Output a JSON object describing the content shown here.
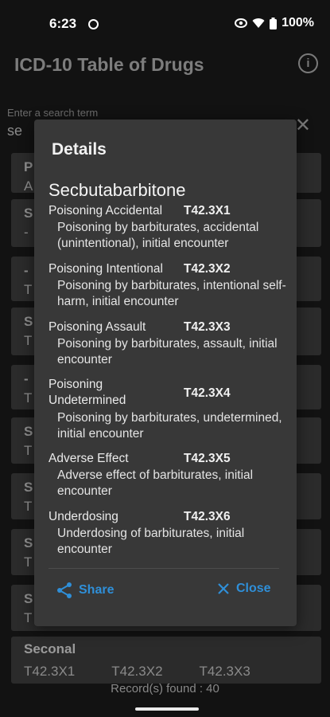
{
  "status_bar": {
    "time": "6:23",
    "battery": "100%"
  },
  "app_bar": {
    "title": "ICD-10 Table of Drugs",
    "info_icon": "info-icon"
  },
  "search": {
    "label": "Enter a search term",
    "value": "se"
  },
  "background_list": {
    "peek_rows": [
      {
        "l1": "P",
        "l2": "A"
      },
      {
        "l1": "S",
        "l2": "-"
      },
      {
        "l1": "-",
        "l2": "T"
      },
      {
        "l1": "S",
        "l2": "T"
      },
      {
        "l1": "-",
        "l2": "T"
      },
      {
        "l1": "S",
        "l2": "T"
      },
      {
        "l1": "S",
        "l2": "T"
      },
      {
        "l1": "S",
        "l2": "T"
      },
      {
        "l1": "S",
        "l2": "T"
      }
    ],
    "last_item": {
      "name": "Seconal",
      "codes": [
        "T42.3X1",
        "T42.3X2",
        "T42.3X3"
      ]
    }
  },
  "records": "Record(s) found : 40",
  "dialog": {
    "title": "Details",
    "drug_name": "Secbutabarbitone",
    "entries": [
      {
        "type": "Poisoning Accidental",
        "code": "T42.3X1",
        "description": "Poisoning by barbiturates, accidental (unintentional), initial encounter"
      },
      {
        "type": "Poisoning Intentional",
        "code": "T42.3X2",
        "description": "Poisoning by barbiturates, intentional self-harm, initial encounter"
      },
      {
        "type": "Poisoning Assault",
        "code": "T42.3X3",
        "description": "Poisoning by barbiturates, assault, initial encounter"
      },
      {
        "type": "Poisoning Undetermined",
        "code": "T42.3X4",
        "description": "Poisoning by barbiturates, undetermined, initial encounter"
      },
      {
        "type": "Adverse Effect",
        "code": "T42.3X5",
        "description": "Adverse effect of barbiturates, initial encounter"
      },
      {
        "type": "Underdosing",
        "code": "T42.3X6",
        "description": "Underdosing of barbiturates, initial encounter"
      }
    ],
    "share_label": "Share",
    "close_label": "Close",
    "accent_color": "#2f8fd8"
  }
}
